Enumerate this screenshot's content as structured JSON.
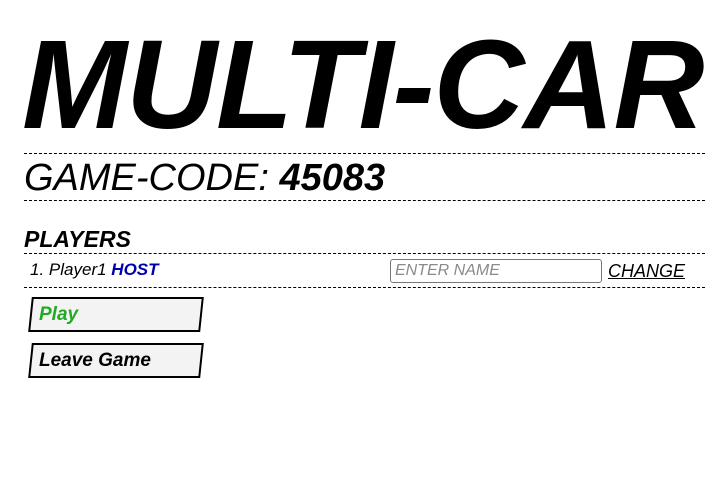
{
  "header": {
    "title": "MULTI-CAR"
  },
  "game": {
    "code_label": "GAME-CODE:",
    "code_value": "45083"
  },
  "players": {
    "heading": "PLAYERS",
    "list": [
      {
        "number": "1.",
        "name": "Player1",
        "badge": "HOST"
      }
    ],
    "name_input": {
      "value": "",
      "placeholder": "ENTER NAME"
    },
    "change_label": "CHANGE"
  },
  "actions": {
    "play_label": "Play",
    "leave_label": "Leave Game"
  },
  "colors": {
    "play_text": "#22aa22",
    "host_badge": "#0000aa"
  }
}
